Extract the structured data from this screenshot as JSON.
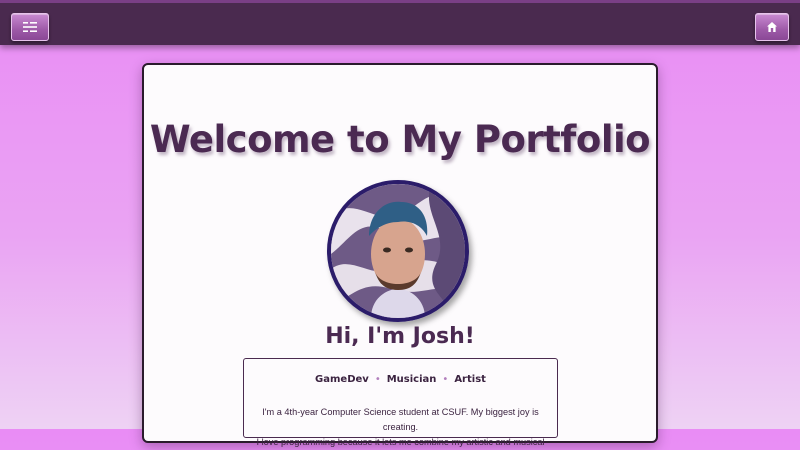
{
  "nav": {
    "menu_icon": "menu-icon",
    "home_icon": "home-icon"
  },
  "main": {
    "title": "Welcome to My Portfolio",
    "greeting": "Hi, I'm Josh!",
    "tags": [
      "GameDev",
      "Musician",
      "Artist"
    ],
    "bio_line1": "I'm a 4th-year Computer Science student at CSUF. My biggest joy is creating.",
    "bio_line2": "I love programming because it lets me combine my artistic and musical"
  },
  "colors": {
    "topbar": "#4a2a4f",
    "accent": "#9e5aa8",
    "heading": "#4b2a52",
    "background_top": "#e98cf5"
  }
}
